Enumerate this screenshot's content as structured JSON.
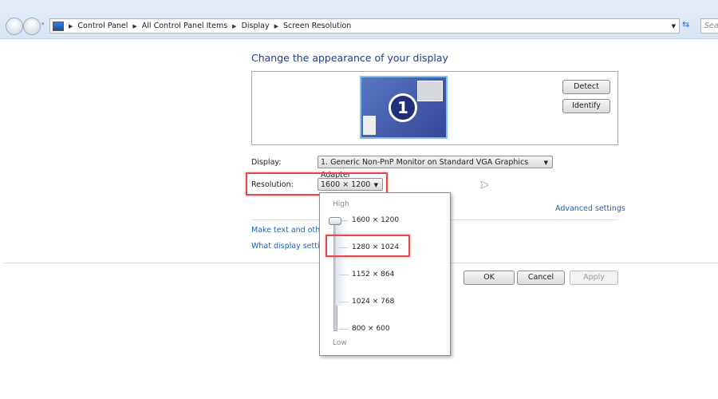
{
  "breadcrumb": [
    "Control Panel",
    "All Control Panel Items",
    "Display",
    "Screen Resolution"
  ],
  "search_placeholder": "Sea",
  "heading": "Change the appearance of your display",
  "monitor_number": "1",
  "buttons": {
    "detect": "Detect",
    "identify": "Identify",
    "ok": "OK",
    "cancel": "Cancel",
    "apply": "Apply"
  },
  "display": {
    "label": "Display:",
    "value": "1. Generic Non-PnP Monitor on Standard VGA Graphics Adapter"
  },
  "resolution": {
    "label": "Resolution:",
    "value": "1600 × 1200",
    "high": "High",
    "low": "Low",
    "options": [
      "1600 × 1200",
      "1280 × 1024",
      "1152 × 864",
      "1024 × 768",
      "800 × 600"
    ],
    "slider_selected": "1600 × 1200",
    "highlighted": "1280 × 1024"
  },
  "links": {
    "advanced": "Advanced settings",
    "text_size": "Make text and other",
    "what_settings": "What display setting"
  },
  "colors": {
    "link": "#1f62b8",
    "highlight": "#e04a4a",
    "monitor": "#3f5aa6"
  }
}
